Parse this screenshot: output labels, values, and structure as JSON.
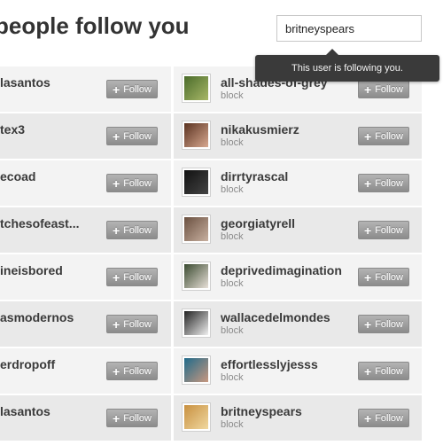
{
  "header": {
    "title": "people follow you",
    "search_value": "britneyspears"
  },
  "tooltip": {
    "text": "This user is following you."
  },
  "follow_label": "Follow",
  "plus_glyph": "+",
  "left_column": [
    {
      "name": "lasantos"
    },
    {
      "name": "tex3"
    },
    {
      "name": "ecoad"
    },
    {
      "name": "tchesofeast..."
    },
    {
      "name": "ineisbored"
    },
    {
      "name": "asmodernos"
    },
    {
      "name": "erdropoff"
    },
    {
      "name": "lasantos"
    }
  ],
  "right_column": [
    {
      "name": "all-shades-of-grey",
      "sub": "block",
      "avatar_colors": [
        "#4a6b2a",
        "#a8b868"
      ]
    },
    {
      "name": "nikakusmierz",
      "sub": "block",
      "avatar_colors": [
        "#5a3220",
        "#d8a890"
      ]
    },
    {
      "name": "dirrtyrascal",
      "sub": "block",
      "avatar_colors": [
        "#111111",
        "#444444"
      ]
    },
    {
      "name": "georgiatyrell",
      "sub": "block",
      "avatar_colors": [
        "#6a5040",
        "#c8b0a0"
      ]
    },
    {
      "name": "deprivedimagination",
      "sub": "block",
      "avatar_colors": [
        "#3a4a30",
        "#e8e0d8"
      ]
    },
    {
      "name": "wallacedelmondes",
      "sub": "block",
      "avatar_colors": [
        "#222222",
        "#f0f0f0"
      ]
    },
    {
      "name": "effortlesslyjesss",
      "sub": "block",
      "avatar_colors": [
        "#1f6a8a",
        "#c89880"
      ]
    },
    {
      "name": "britneyspears",
      "sub": "block",
      "avatar_colors": [
        "#c89040",
        "#f0d8a0"
      ]
    }
  ]
}
